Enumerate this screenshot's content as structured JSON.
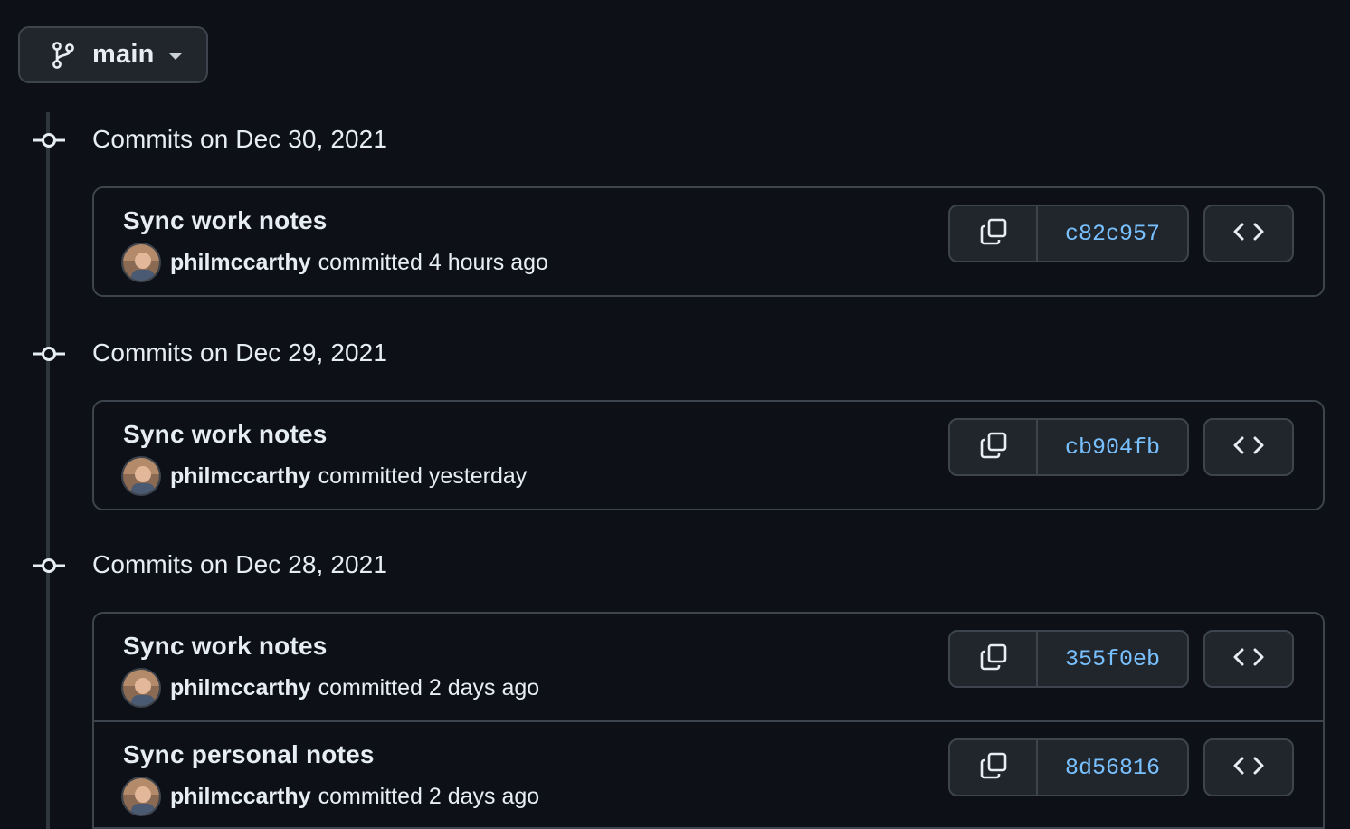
{
  "branch": {
    "label": "main",
    "icon": "git-branch-icon"
  },
  "groups": [
    {
      "heading": "Commits on Dec 30, 2021",
      "commits": [
        {
          "message": "Sync work notes",
          "author": "philmccarthy",
          "time_text": "committed 4 hours ago",
          "sha": "c82c957"
        }
      ]
    },
    {
      "heading": "Commits on Dec 29, 2021",
      "commits": [
        {
          "message": "Sync work notes",
          "author": "philmccarthy",
          "time_text": "committed yesterday",
          "sha": "cb904fb"
        }
      ]
    },
    {
      "heading": "Commits on Dec 28, 2021",
      "commits": [
        {
          "message": "Sync work notes",
          "author": "philmccarthy",
          "time_text": "committed 2 days ago",
          "sha": "355f0eb"
        },
        {
          "message": "Sync personal notes",
          "author": "philmccarthy",
          "time_text": "committed 2 days ago",
          "sha": "8d56816"
        }
      ]
    }
  ],
  "colors": {
    "background": "#0d1117",
    "border": "#3d444d",
    "button": "#21262d",
    "sha_link": "#79c0ff"
  },
  "icons": {
    "copy": "copy-icon",
    "browse": "code-icon",
    "node": "git-commit-icon"
  }
}
